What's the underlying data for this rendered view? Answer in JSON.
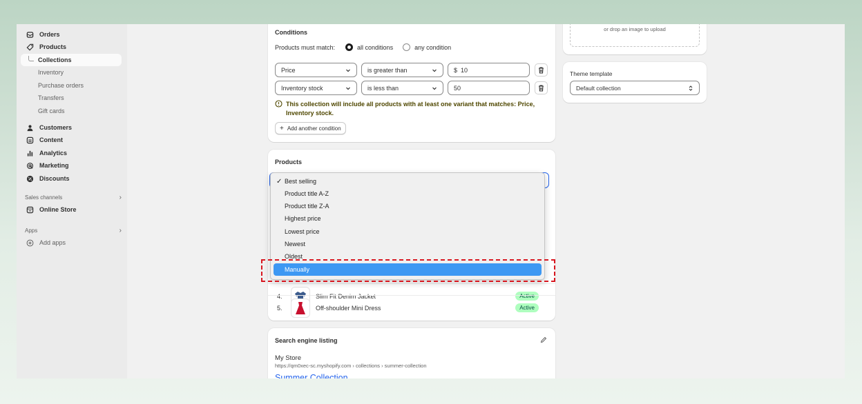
{
  "sidebar": {
    "items": [
      {
        "label": "Orders",
        "icon": "orders-icon"
      },
      {
        "label": "Products",
        "icon": "tag-icon"
      },
      {
        "label": "Collections"
      },
      {
        "label": "Inventory"
      },
      {
        "label": "Purchase orders"
      },
      {
        "label": "Transfers"
      },
      {
        "label": "Gift cards"
      },
      {
        "label": "Customers",
        "icon": "person-icon"
      },
      {
        "label": "Content",
        "icon": "content-icon"
      },
      {
        "label": "Analytics",
        "icon": "bar-chart-icon"
      },
      {
        "label": "Marketing",
        "icon": "target-icon"
      },
      {
        "label": "Discounts",
        "icon": "discount-icon"
      }
    ],
    "sales_channels_label": "Sales channels",
    "online_store": "Online Store",
    "apps_label": "Apps",
    "add_apps": "Add apps"
  },
  "conditions": {
    "title": "Conditions",
    "must_match_label": "Products must match:",
    "all_conditions": "all conditions",
    "any_condition": "any condition",
    "rules": [
      {
        "field": "Price",
        "operator": "is greater than",
        "prefix": "$",
        "value": "10"
      },
      {
        "field": "Inventory stock",
        "operator": "is less than",
        "prefix": "",
        "value": "50"
      }
    ],
    "notice_line1": "This collection will include all products with at least one variant that matches: Price,",
    "notice_line2": "Inventory stock.",
    "add_condition": "Add another condition"
  },
  "products": {
    "title": "Products",
    "sort_options": [
      "Best selling",
      "Product title A-Z",
      "Product title Z-A",
      "Highest price",
      "Lowest price",
      "Newest",
      "Oldest",
      "Manually"
    ],
    "selected": "Best selling",
    "hovered": "Manually",
    "rows": [
      {
        "index": "4.",
        "name": "Slim Fit Denim Jacket",
        "status": "Active"
      },
      {
        "index": "5.",
        "name": "Off-shoulder Mini Dress",
        "status": "Active"
      }
    ]
  },
  "seo": {
    "title": "Search engine listing",
    "store_name": "My Store",
    "url": "https://qm0xec-sc.myshopify.com › collections › summer-collection",
    "page_title": "Summer Collection"
  },
  "image_upload": {
    "hint": "or drop an image to upload"
  },
  "theme": {
    "label": "Theme template",
    "value": "Default collection"
  },
  "colors": {
    "accent": "#3d98f3",
    "highlight_border": "#d8161f",
    "badge_bg": "#affebf"
  }
}
